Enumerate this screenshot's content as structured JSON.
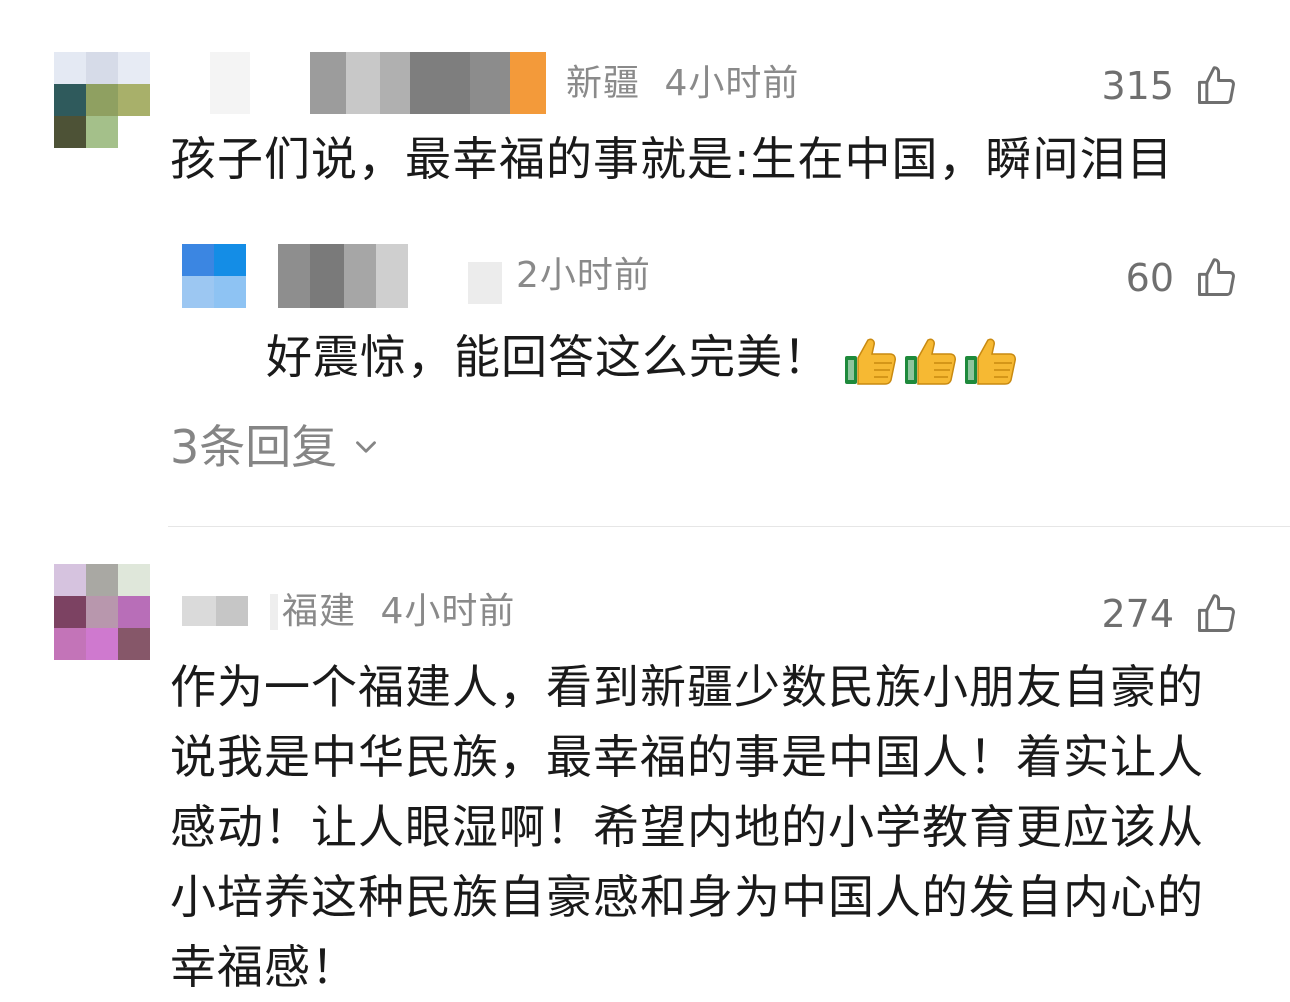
{
  "comments": [
    {
      "location": "新疆",
      "time": "4小时前",
      "like_count": "315",
      "text": "孩子们说，最幸福的事就是:生在中国，瞬间泪目",
      "reply": {
        "time": "2小时前",
        "like_count": "60",
        "text": "好震惊，能回答这么完美！"
      },
      "replies_toggle": "3条回复"
    },
    {
      "location": "福建",
      "time": "4小时前",
      "like_count": "274",
      "text": "作为一个福建人，看到新疆少数民族小朋友自豪的说我是中华民族，最幸福的事是中国人！着实让人感动！让人眼湿啊！希望内地的小学教育更应该从小培养这种民族自豪感和身为中国人的发自内心的幸福感！"
    }
  ],
  "icons": {
    "like": "thumbs-up-outline-icon",
    "expand": "chevron-down-icon",
    "emoji": "thumbs-up-emoji"
  },
  "colors": {
    "meta_text": "#8a8a8a",
    "body_text": "#1a1a1a",
    "divider": "#e6e6e6"
  }
}
